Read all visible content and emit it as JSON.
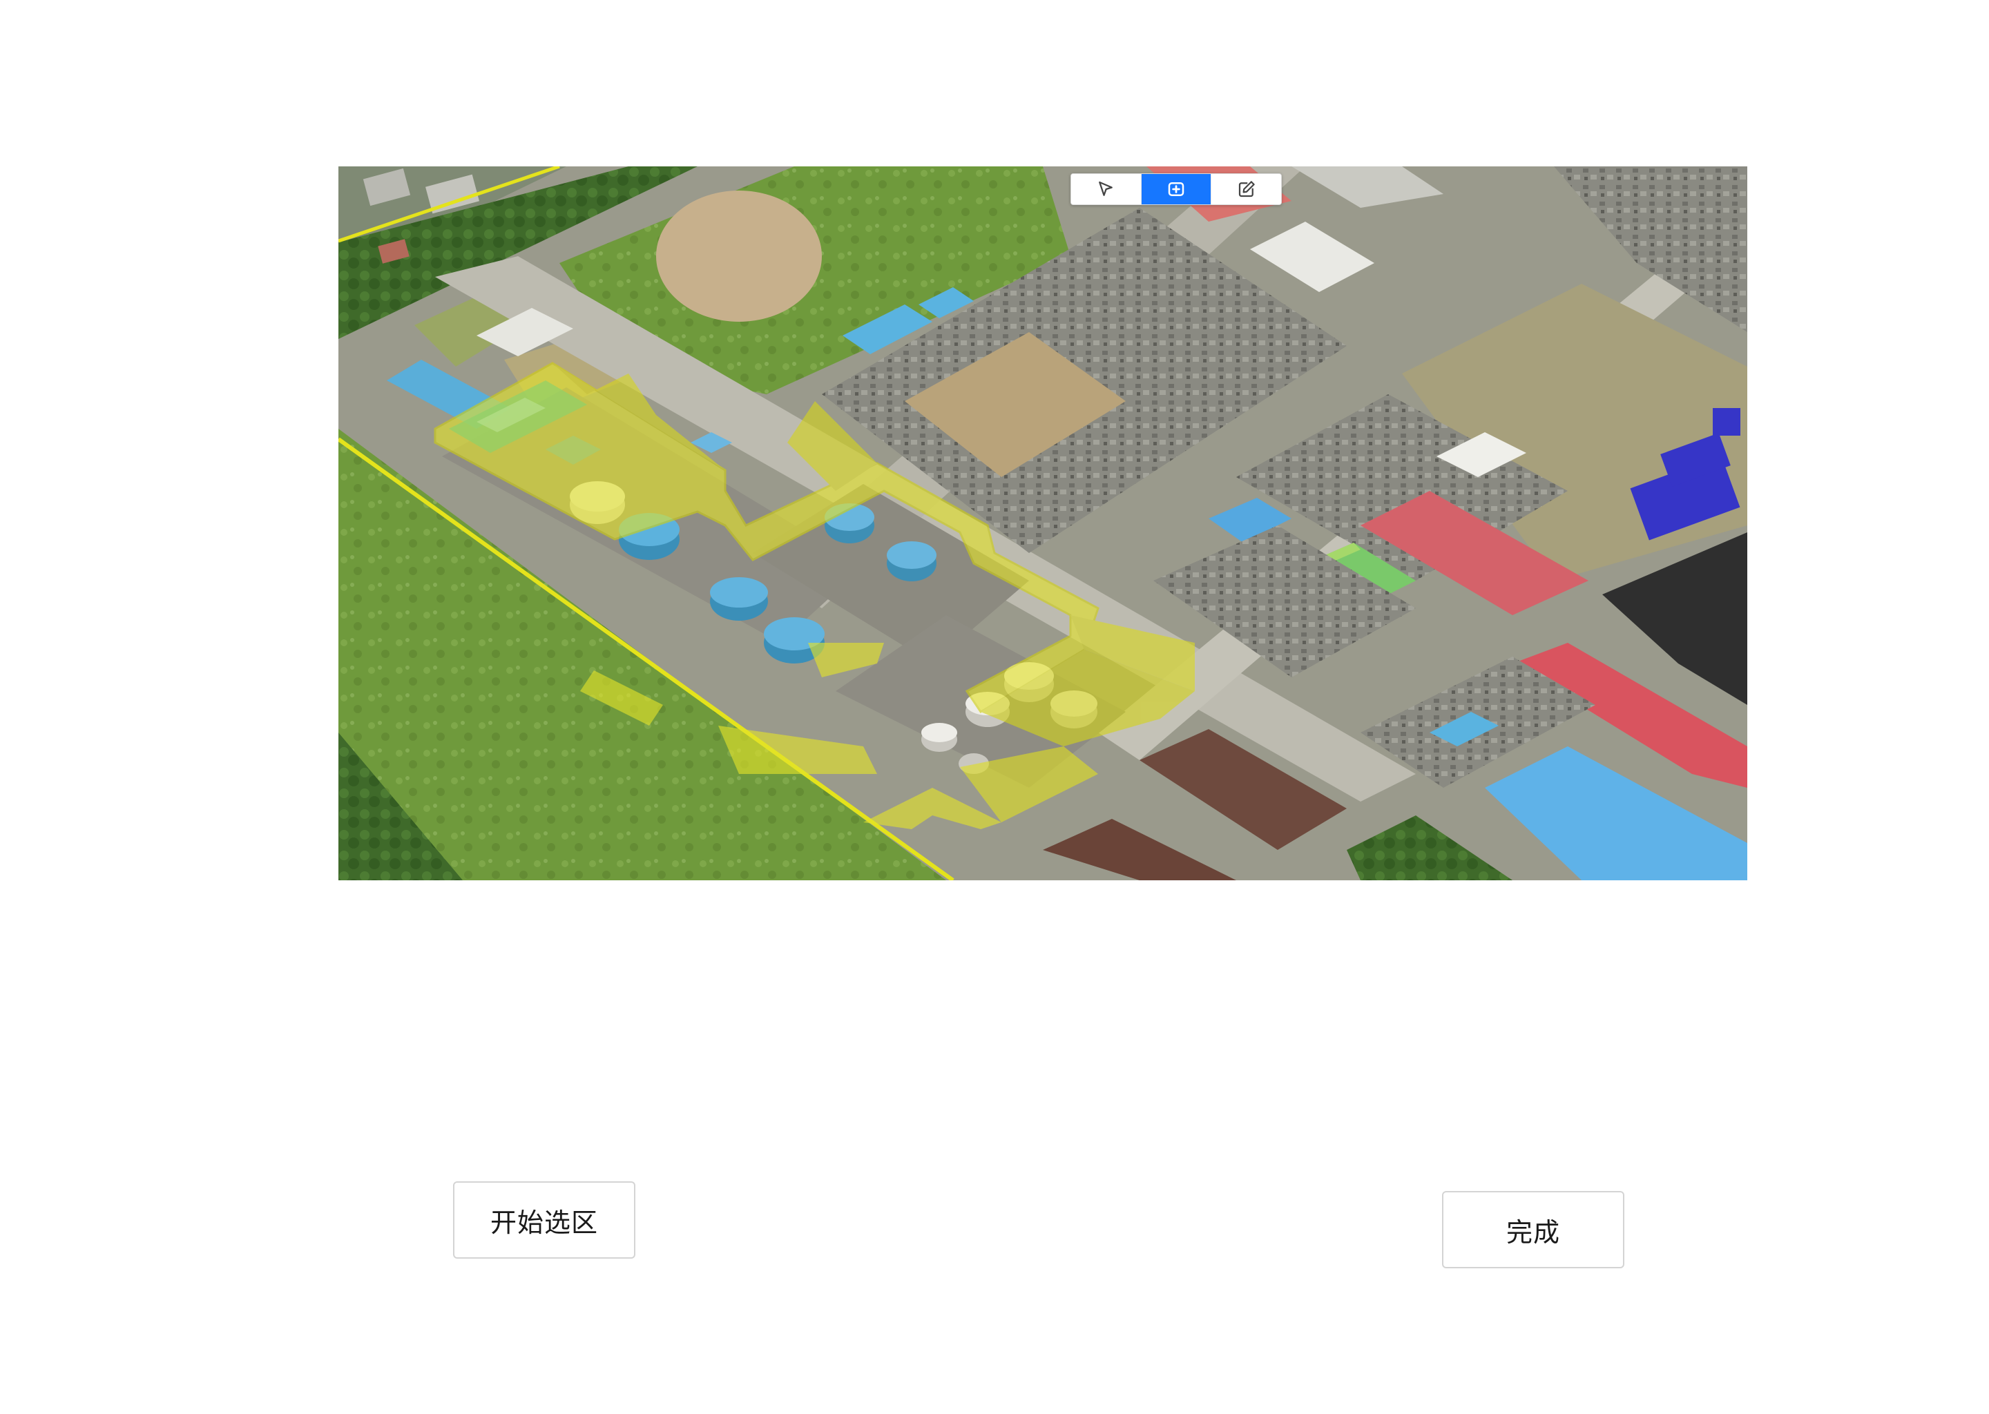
{
  "map": {
    "toolbar": {
      "tools": [
        {
          "id": "select",
          "icon": "cursor-arrow-icon",
          "active": false
        },
        {
          "id": "add-area",
          "icon": "plus-square-icon",
          "active": true
        },
        {
          "id": "edit",
          "icon": "pencil-edit-icon",
          "active": false
        }
      ],
      "active_color": "#1677ff"
    },
    "highlight_color": "#e3e32a"
  },
  "buttons": {
    "start_select_label": "开始选区",
    "done_label": "完成"
  }
}
